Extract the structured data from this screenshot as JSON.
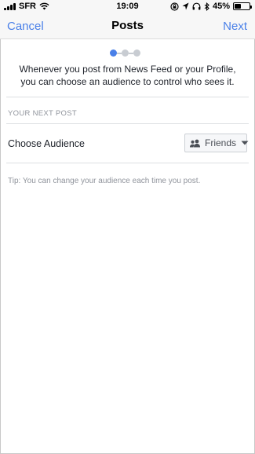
{
  "status_bar": {
    "carrier": "SFR",
    "time": "19:09",
    "battery": "45%",
    "battery_level": 0.45
  },
  "nav": {
    "cancel": "Cancel",
    "title": "Posts",
    "next": "Next"
  },
  "progress": {
    "current_step": 1,
    "total_steps": 3
  },
  "intro": "Whenever you post from News Feed or your Profile, you can choose an audience to control who sees it.",
  "section_header": "YOUR NEXT POST",
  "audience": {
    "label": "Choose Audience",
    "selected": "Friends"
  },
  "tip": "Tip: You can change your audience each time you post.",
  "colors": {
    "accent": "#4a80e8",
    "muted": "#90949c"
  }
}
